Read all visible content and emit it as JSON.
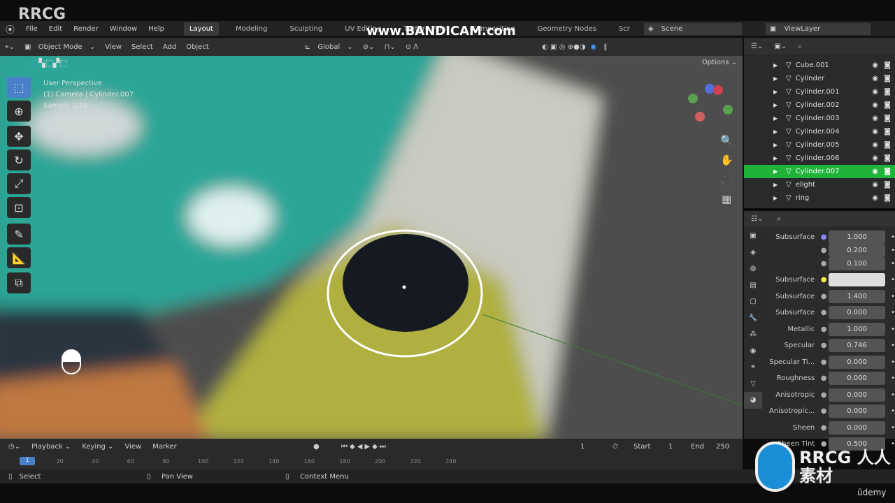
{
  "watermarks": {
    "top_left": "RRCG",
    "center": "www.BANDICAM.com",
    "bottom_right": "RRCG 人人素材",
    "udemy": "ūdemy"
  },
  "menu": [
    "File",
    "Edit",
    "Render",
    "Window",
    "Help"
  ],
  "workspaces": [
    "Layout",
    "Modeling",
    "Sculpting",
    "UV Editing",
    "Texture Paint",
    "Compositing",
    "Geometry Nodes",
    "Scr"
  ],
  "scene": "Scene",
  "view_layer": "ViewLayer",
  "toolbar": {
    "mode": "Object Mode",
    "items": [
      "View",
      "Select",
      "Add",
      "Object"
    ],
    "orientation": "Global",
    "options": "Options"
  },
  "viewport": {
    "info": [
      "User Perspective",
      "(1) Camera | Cylinder.007",
      "Sample 1/10"
    ]
  },
  "outliner": {
    "items": [
      {
        "name": "Cube.001"
      },
      {
        "name": "Cylinder"
      },
      {
        "name": "Cylinder.001"
      },
      {
        "name": "Cylinder.002"
      },
      {
        "name": "Cylinder.003"
      },
      {
        "name": "Cylinder.004"
      },
      {
        "name": "Cylinder.005"
      },
      {
        "name": "Cylinder.006"
      },
      {
        "name": "Cylinder.007",
        "selected": true
      },
      {
        "name": "elight"
      },
      {
        "name": "ring"
      }
    ]
  },
  "properties": {
    "rows": [
      {
        "label": "Subsurface",
        "value": "1.000"
      },
      {
        "label": "",
        "value": "0.200"
      },
      {
        "label": "",
        "value": "0.100"
      },
      {
        "label": "Subsurface",
        "value": ""
      },
      {
        "label": "Subsurface",
        "value": "1.400"
      },
      {
        "label": "Subsurface",
        "value": "0.000"
      },
      {
        "label": "Metallic",
        "value": "1.000"
      },
      {
        "label": "Specular",
        "value": "0.746"
      },
      {
        "label": "Specular Ti...",
        "value": "0.000"
      },
      {
        "label": "Roughness",
        "value": "0.000"
      },
      {
        "label": "Anisotropic",
        "value": "0.000"
      },
      {
        "label": "Anisotropic...",
        "value": "0.000"
      },
      {
        "label": "Sheen",
        "value": "0.000"
      },
      {
        "label": "Sheen Tint",
        "value": "0.500"
      }
    ]
  },
  "timeline": {
    "menus": [
      "Playback",
      "Keying",
      "View",
      "Marker"
    ],
    "current": "1",
    "start_label": "Start",
    "start": "1",
    "end_label": "End",
    "end": "250",
    "ticks": [
      "1",
      "20",
      "40",
      "60",
      "80",
      "100",
      "120",
      "140",
      "160",
      "180",
      "200",
      "220",
      "240"
    ]
  },
  "status": {
    "select": "Select",
    "pan": "Pan View",
    "context": "Context Menu"
  },
  "colors": {
    "selected": "#1fb33a",
    "accent": "#4a7fc9"
  }
}
